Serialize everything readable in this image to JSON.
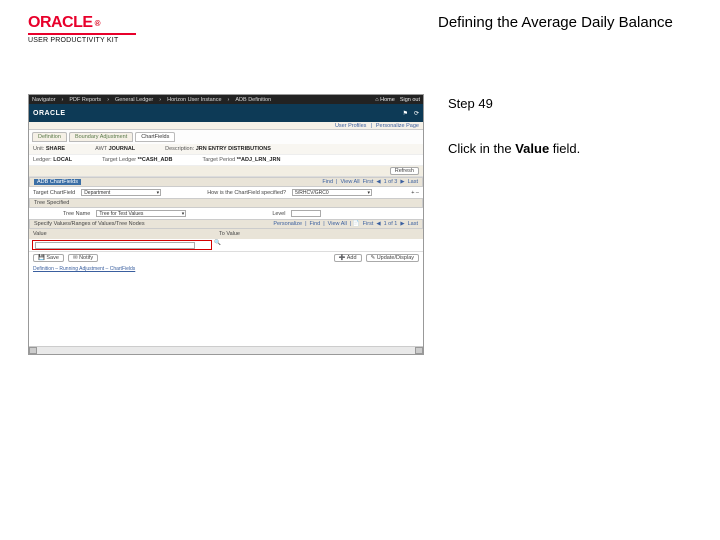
{
  "brand": {
    "name": "ORACLE",
    "subtitle": "USER PRODUCTIVITY KIT"
  },
  "doc": {
    "title": "Defining the Average Daily Balance"
  },
  "step": {
    "label": "Step 49"
  },
  "instruction": {
    "prefix": "Click in the ",
    "bold": "Value",
    "suffix": " field."
  },
  "shot": {
    "topbar": {
      "items": [
        "Navigator",
        "PDF Reports",
        "General Ledger",
        "Horizon User Instance",
        "ADB Definition"
      ],
      "home": "Home",
      "signout": "Sign out"
    },
    "brandbar": {
      "brand": "ORACLE",
      "icons": [
        "Accessibility",
        "Help"
      ]
    },
    "subbar": {
      "links": [
        "User Profiles",
        "Personalize Page"
      ]
    },
    "tabs": [
      {
        "label": "Definition",
        "active": false
      },
      {
        "label": "Boundary Adjustment",
        "active": false
      },
      {
        "label": "ChartFields",
        "active": true
      }
    ],
    "info": {
      "unitLabel": "Unit:",
      "unitVal": "SHARE",
      "awtLabel": "AWT",
      "awtVal": "JOURNAL",
      "descrLabel": "Description:",
      "descrVal": "JRN ENTRY DISTRIBUTIONS",
      "ledgerLabel": "Ledger:",
      "ledgerVal": "LOCAL",
      "targetLabel": "Target Ledger",
      "targetVal": "**CASH_ADB",
      "targetPeriodLabel": "Target Period",
      "targetPeriodVal": "**ADJ_LRN_JRN"
    },
    "actionBtn": "Refresh",
    "adbSection": "ADB ChartFields",
    "panelNav": {
      "find": "Find",
      "viewall": "View All",
      "first": "First",
      "pos": "1 of 3",
      "last": "Last"
    },
    "targetCF": {
      "label": "Target ChartField",
      "value": "Department"
    },
    "howCF": {
      "label": "How is the ChartField specified?",
      "value": "5/RHCV/GRC0"
    },
    "glyph": "+ –",
    "treeSection": "Tree Specified",
    "treeName": {
      "label": "Tree Name",
      "value": "Tree for Test Values"
    },
    "level": {
      "label": "Level"
    },
    "specifySection": "Specify Values/Ranges of Values/Tree Nodes",
    "specifyNav": {
      "personalize": "Personalize",
      "find": "Find",
      "viewall": "View All",
      "pos": "1 of 1",
      "first": "First",
      "last": "Last"
    },
    "valueCol": "Value",
    "toValueCol": "To Value",
    "footer": {
      "save": "Save",
      "notify": "Notify",
      "add": "Add",
      "update": "Update/Display"
    },
    "bottomTabs": "Definition – Running Adjustment – ChartFields"
  }
}
